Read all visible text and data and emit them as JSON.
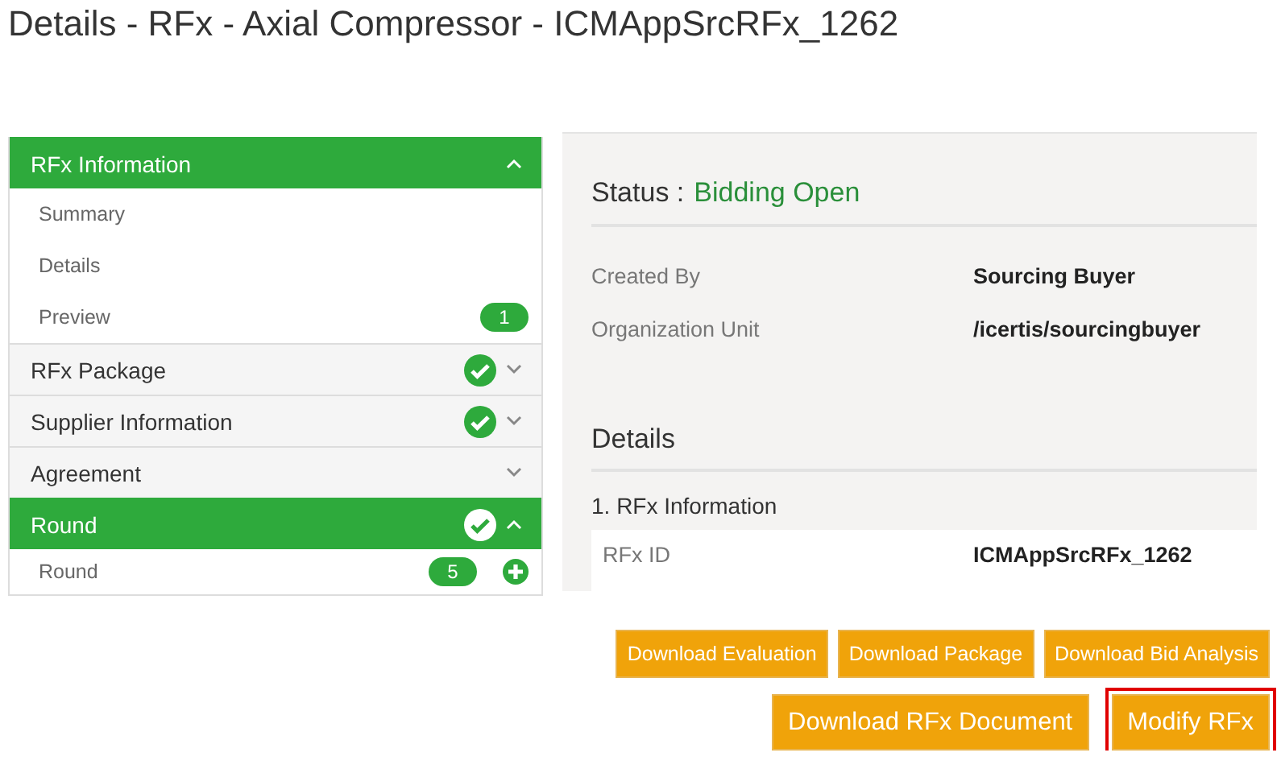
{
  "page": {
    "title": "Details - RFx - Axial Compressor - ICMAppSrcRFx_1262"
  },
  "sidebar": {
    "sections": [
      {
        "label": "RFx Information",
        "expanded": true,
        "complete": false,
        "children": [
          {
            "label": "Summary",
            "add": false
          },
          {
            "label": "Details",
            "add": false
          },
          {
            "label": "Preview",
            "badge": "1",
            "add": false
          }
        ]
      },
      {
        "label": "RFx Package",
        "expanded": false,
        "complete": true
      },
      {
        "label": "Supplier Information",
        "expanded": false,
        "complete": true
      },
      {
        "label": "Agreement",
        "expanded": false,
        "complete": false
      },
      {
        "label": "Round",
        "expanded": true,
        "complete": true,
        "children": [
          {
            "label": "Round",
            "badge": "5",
            "add": true
          }
        ]
      }
    ]
  },
  "status": {
    "label": "Status :",
    "value": "Bidding Open"
  },
  "fields": [
    {
      "label": "Created By",
      "value": "Sourcing Buyer"
    },
    {
      "label": "Organization Unit",
      "value": "/icertis/sourcingbuyer"
    }
  ],
  "details": {
    "heading": "Details",
    "section": "1. RFx Information",
    "rows": [
      {
        "label": "RFx ID",
        "value": "ICMAppSrcRFx_1262"
      }
    ]
  },
  "button_rows": [
    {
      "buttons": [
        {
          "label": "Download Evaluation",
          "highlighted": false
        },
        {
          "label": "Download Package",
          "highlighted": false
        },
        {
          "label": "Download Bid Analysis",
          "highlighted": false
        }
      ]
    },
    {
      "buttons": [
        {
          "label": "Download RFx Document",
          "highlighted": false
        },
        {
          "label": "Modify RFx",
          "highlighted": true
        }
      ]
    }
  ]
}
